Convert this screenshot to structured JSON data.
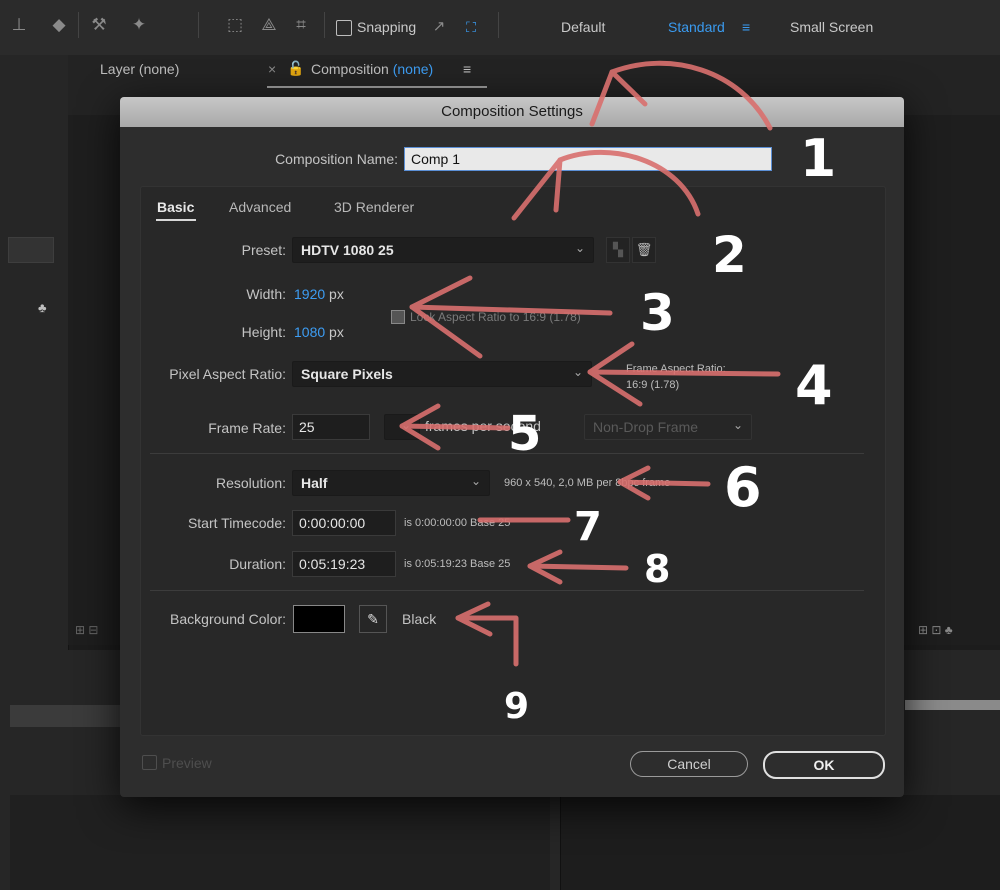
{
  "toolbar": {
    "snapping_label": "Snapping",
    "workspaces": [
      {
        "label": "Default"
      },
      {
        "label": "Standard"
      },
      {
        "label": "Small Screen"
      }
    ]
  },
  "panels": {
    "layer_tab": "Layer (none)",
    "comp_tab_prefix": "Composition",
    "comp_tab_value": "(none)"
  },
  "dialog": {
    "title": "Composition Settings",
    "comp_name_label": "Composition Name:",
    "comp_name_value": "Comp 1",
    "tabs": [
      "Basic",
      "Advanced",
      "3D Renderer"
    ],
    "preset_label": "Preset:",
    "preset_value": "HDTV 1080 25",
    "width_label": "Width:",
    "width_value": "1920",
    "height_label": "Height:",
    "height_value": "1080",
    "px_unit": "px",
    "lock_aspect_text": "Lock Aspect Ratio to 16:9 (1.78)",
    "par_label": "Pixel Aspect Ratio:",
    "par_value": "Square Pixels",
    "frame_aspect_label": "Frame Aspect Ratio:",
    "frame_aspect_value": "16:9 (1.78)",
    "frame_rate_label": "Frame Rate:",
    "frame_rate_value": "25",
    "frames_per_second": "frames per second",
    "drop_frame_value": "Non-Drop Frame",
    "resolution_label": "Resolution:",
    "resolution_value": "Half",
    "resolution_info": "960 x 540, 2,0 MB per 8bpc frame",
    "start_tc_label": "Start Timecode:",
    "start_tc_value": "0:00:00:00",
    "start_tc_info": "is 0:00:00:00  Base 25",
    "duration_label": "Duration:",
    "duration_value": "0:05:19:23",
    "duration_info": "is 0:05:19:23  Base 25",
    "bg_color_label": "Background Color:",
    "bg_color_name": "Black",
    "preview_label": "Preview",
    "cancel_label": "Cancel",
    "ok_label": "OK"
  },
  "annotations": [
    "1",
    "2",
    "3",
    "4",
    "5",
    "6",
    "7",
    "8",
    "9"
  ],
  "colors": {
    "accent_blue": "#3d9df3",
    "annotation_arrow": "#d9706e",
    "background_color_swatch": "#000000"
  }
}
